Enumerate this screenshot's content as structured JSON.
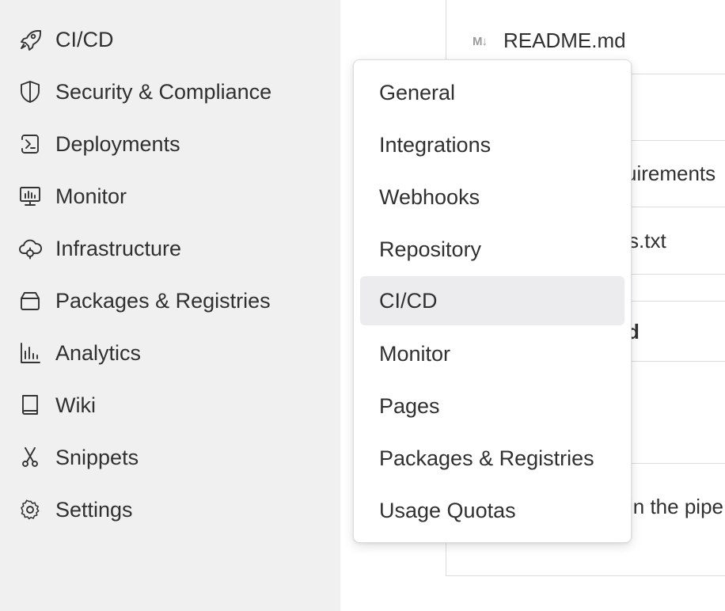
{
  "sidebar": {
    "items": [
      {
        "label": "CI/CD",
        "icon": "rocket-icon"
      },
      {
        "label": "Security & Compliance",
        "icon": "shield-icon"
      },
      {
        "label": "Deployments",
        "icon": "deployments-icon"
      },
      {
        "label": "Monitor",
        "icon": "monitor-icon"
      },
      {
        "label": "Infrastructure",
        "icon": "cloud-gear-icon"
      },
      {
        "label": "Packages & Registries",
        "icon": "package-icon"
      },
      {
        "label": "Analytics",
        "icon": "analytics-icon"
      },
      {
        "label": "Wiki",
        "icon": "book-icon"
      },
      {
        "label": "Snippets",
        "icon": "scissors-icon"
      },
      {
        "label": "Settings",
        "icon": "gear-icon"
      }
    ]
  },
  "main": {
    "readme_icon": "M↓",
    "readme_label": "README.md",
    "partial_texts": [
      "uirements",
      "s.txt",
      "d",
      "in the pipe"
    ]
  },
  "dropdown": {
    "active_item": "CI/CD",
    "items": [
      {
        "label": "General"
      },
      {
        "label": "Integrations"
      },
      {
        "label": "Webhooks"
      },
      {
        "label": "Repository"
      },
      {
        "label": "CI/CD"
      },
      {
        "label": "Monitor"
      },
      {
        "label": "Pages"
      },
      {
        "label": "Packages & Registries"
      },
      {
        "label": "Usage Quotas"
      }
    ]
  },
  "colors": {
    "sidebar_bg": "#f0f0f0",
    "active_item_bg": "#ececef",
    "text": "#303030",
    "border": "#dcdcdc"
  }
}
